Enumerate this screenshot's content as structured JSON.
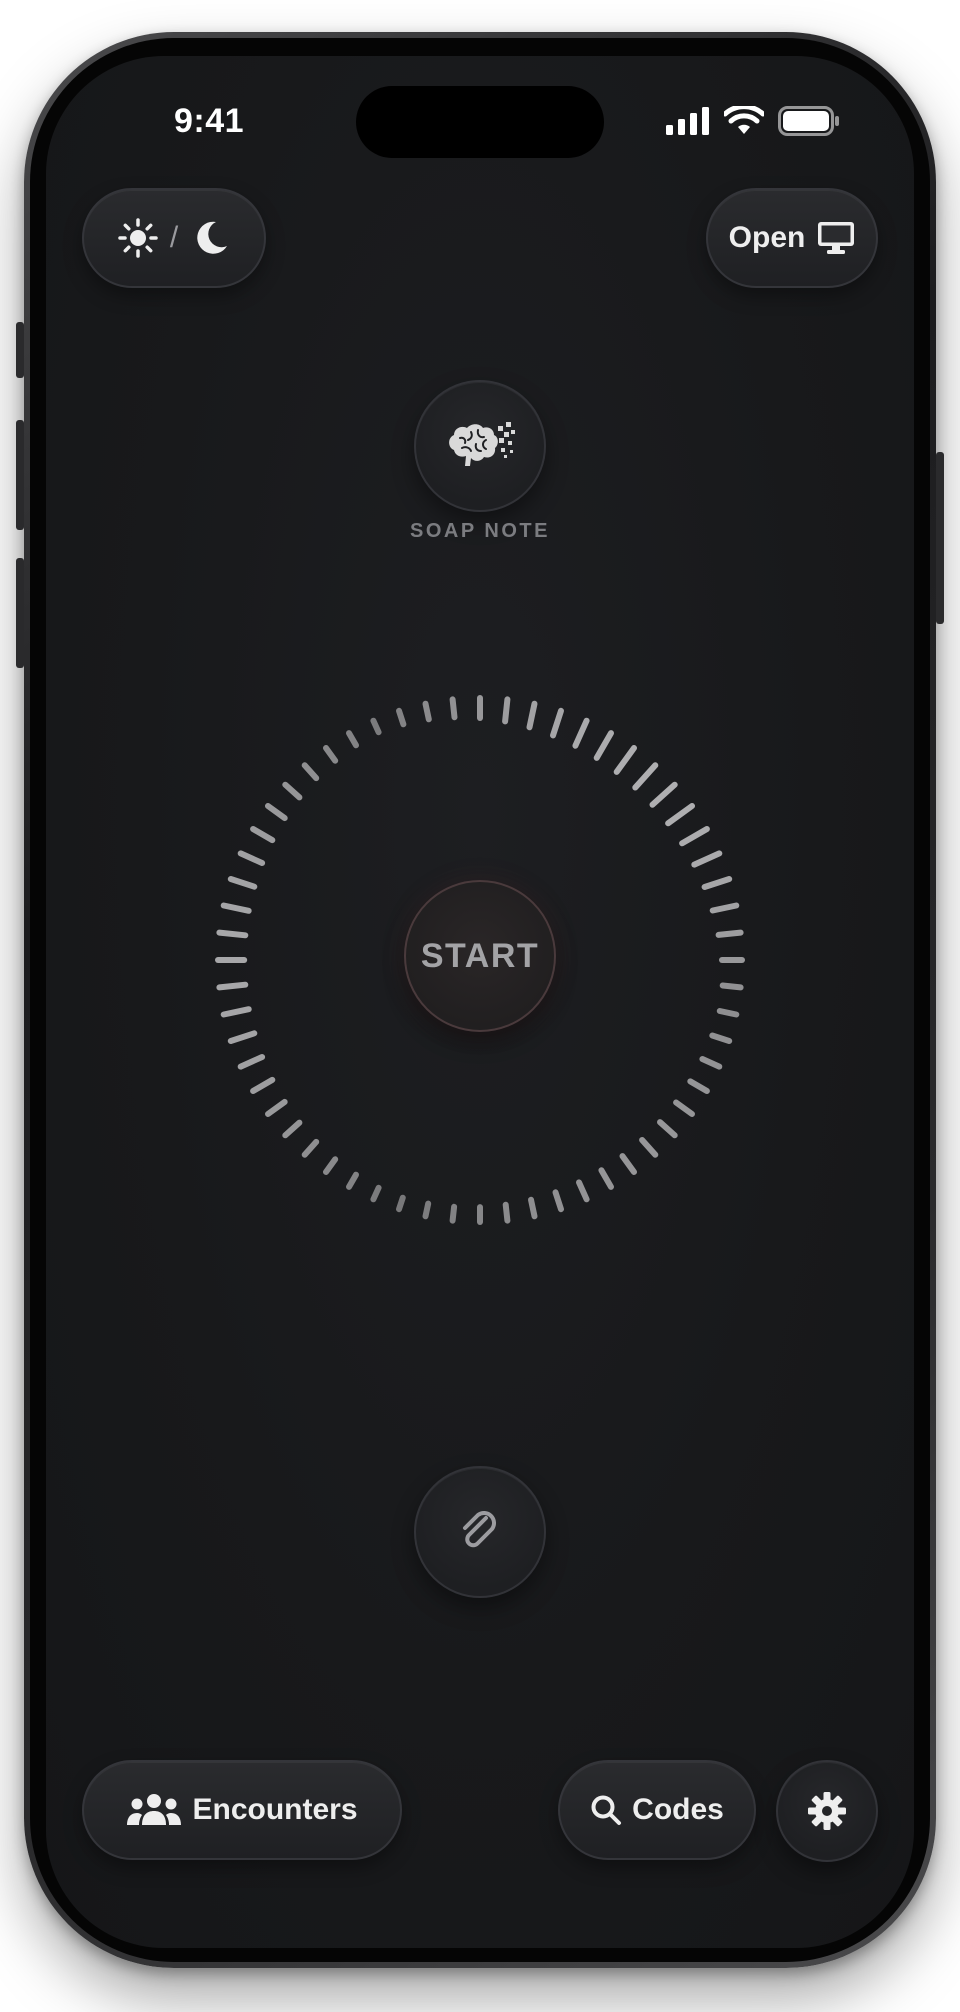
{
  "status_bar": {
    "time": "9:41"
  },
  "top_bar": {
    "theme_toggle_separator": "/",
    "open_label": "Open"
  },
  "soap": {
    "label": "SOAP NOTE"
  },
  "recorder": {
    "start_label": "START",
    "tick_count": 60
  },
  "bottom_bar": {
    "encounters_label": "Encounters",
    "codes_label": "Codes"
  },
  "icons": {
    "sun": "sun-icon",
    "moon": "moon-icon",
    "monitor": "monitor-icon",
    "brain": "brain-icon",
    "paperclip": "paperclip-icon",
    "users": "users-icon",
    "search": "search-icon",
    "gear": "gear-icon"
  },
  "colors": {
    "screen_background": "#18191b",
    "pill_background": "#242528",
    "text_primary": "#eeeeee",
    "text_muted": "#7b7c80",
    "start_ring": "#4a3a3c"
  }
}
